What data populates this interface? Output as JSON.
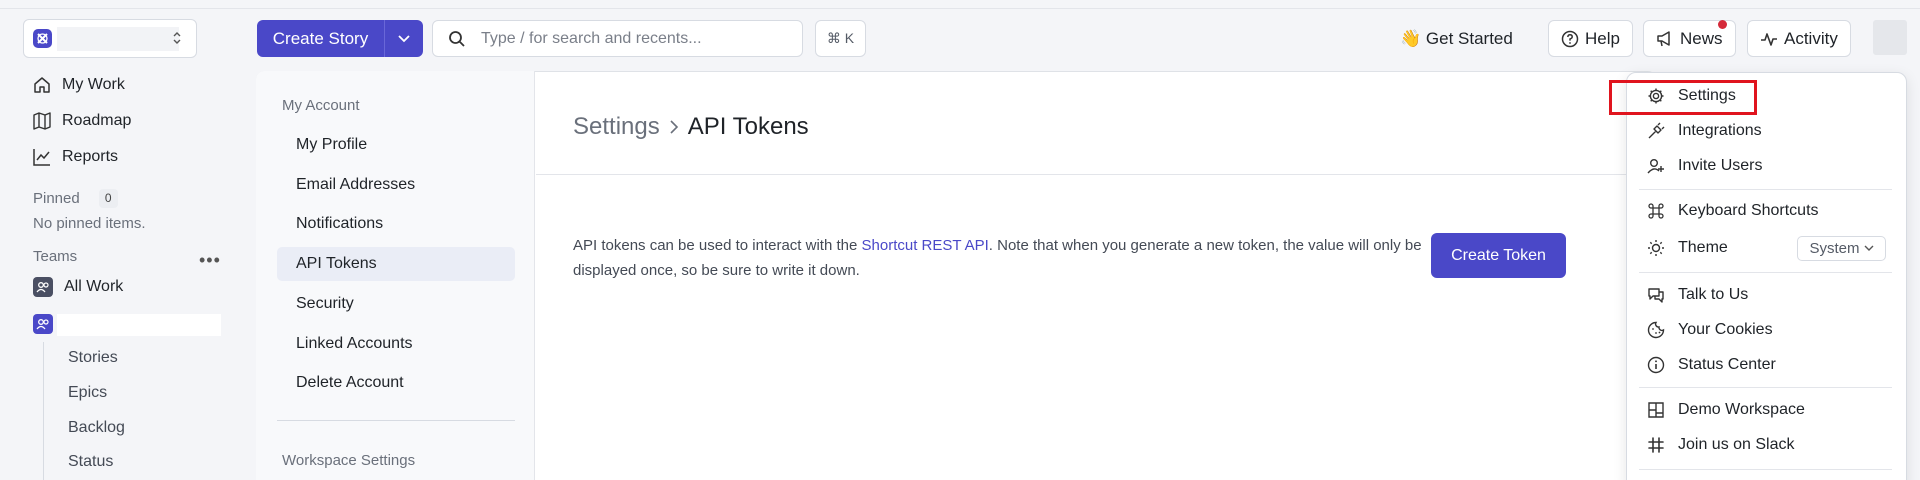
{
  "header": {
    "create_story_label": "Create Story",
    "search_placeholder": "Type / for search and recents...",
    "shortcut_hint": "⌘ K",
    "get_started_label": "👋 Get Started",
    "help_label": "Help",
    "news_label": "News",
    "activity_label": "Activity"
  },
  "sidebar": {
    "items": [
      {
        "label": "My Work",
        "icon": "home-icon"
      },
      {
        "label": "Roadmap",
        "icon": "map-icon"
      },
      {
        "label": "Reports",
        "icon": "chart-icon"
      }
    ],
    "pinned_label": "Pinned",
    "pinned_count": "0",
    "pinned_empty": "No pinned items.",
    "teams_label": "Teams",
    "all_work_label": "All Work",
    "team_sub_items": [
      "Stories",
      "Epics",
      "Backlog",
      "Status"
    ]
  },
  "settings_nav": {
    "section_account": "My Account",
    "items": [
      "My Profile",
      "Email Addresses",
      "Notifications",
      "API Tokens",
      "Security",
      "Linked Accounts",
      "Delete Account"
    ],
    "active_item": "API Tokens",
    "section_workspace": "Workspace Settings"
  },
  "main": {
    "breadcrumb_parent": "Settings",
    "breadcrumb_current": "API Tokens",
    "description_before": "API tokens can be used to interact with the ",
    "description_link": "Shortcut REST API",
    "description_after": ". Note that when you generate a new token, the value will only be displayed once, so be sure to write it down.",
    "create_token_label": "Create Token"
  },
  "menu": {
    "items": [
      {
        "label": "Settings",
        "icon": "gear-icon"
      },
      {
        "label": "Integrations",
        "icon": "plug-icon"
      },
      {
        "label": "Invite Users",
        "icon": "user-plus-icon"
      },
      {
        "label": "Keyboard Shortcuts",
        "icon": "command-icon"
      },
      {
        "label": "Theme",
        "icon": "sun-icon"
      },
      {
        "label": "Talk to Us",
        "icon": "chat-icon"
      },
      {
        "label": "Your Cookies",
        "icon": "cookie-icon"
      },
      {
        "label": "Status Center",
        "icon": "info-icon"
      },
      {
        "label": "Demo Workspace",
        "icon": "layout-icon"
      },
      {
        "label": "Join us on Slack",
        "icon": "slack-icon"
      }
    ],
    "theme_value": "System",
    "highlighted_item": "Settings"
  },
  "colors": {
    "brand": "#4a48c8",
    "highlight_box": "#e0141e",
    "news_badge": "#d52a3a"
  }
}
